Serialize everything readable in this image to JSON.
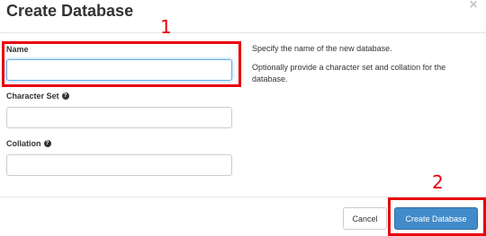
{
  "dialog": {
    "title": "Create Database",
    "close_symbol": "×"
  },
  "form": {
    "name": {
      "label": "Name",
      "value": "",
      "placeholder": ""
    },
    "character_set": {
      "label": "Character Set",
      "value": "",
      "placeholder": ""
    },
    "collation": {
      "label": "Collation",
      "value": "",
      "placeholder": ""
    },
    "help_icon": "?"
  },
  "help": {
    "line1": "Specify the name of the new database.",
    "line2": "Optionally provide a character set and collation for the database."
  },
  "footer": {
    "cancel_label": "Cancel",
    "create_label": "Create Database"
  },
  "annotations": [
    {
      "number": "1",
      "color": "#e8000b"
    },
    {
      "number": "2",
      "color": "#e8000b"
    }
  ],
  "colors": {
    "primary": "#428bca",
    "annotation": "#e8000b",
    "focus": "#66afe9"
  }
}
